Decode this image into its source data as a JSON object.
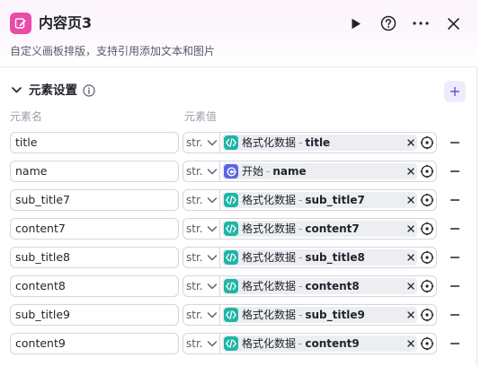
{
  "header": {
    "title": "内容页3",
    "description": "自定义画板排版，支持引用添加文本和图片"
  },
  "section": {
    "title": "元素设置"
  },
  "columns": {
    "name": "元素名",
    "value": "元素值"
  },
  "rows": [
    {
      "name": "title",
      "type": "str.",
      "source": "格式化数据",
      "sep": "-",
      "var": "title",
      "source_kind": "format"
    },
    {
      "name": "name",
      "type": "str.",
      "source": "开始",
      "sep": "-",
      "var": "name",
      "source_kind": "start"
    },
    {
      "name": "sub_title7",
      "type": "str.",
      "source": "格式化数据",
      "sep": "-",
      "var": "sub_title7",
      "source_kind": "format"
    },
    {
      "name": "content7",
      "type": "str.",
      "source": "格式化数据",
      "sep": "-",
      "var": "content7",
      "source_kind": "format"
    },
    {
      "name": "sub_title8",
      "type": "str.",
      "source": "格式化数据",
      "sep": "-",
      "var": "sub_title8",
      "source_kind": "format"
    },
    {
      "name": "content8",
      "type": "str.",
      "source": "格式化数据",
      "sep": "-",
      "var": "content8",
      "source_kind": "format"
    },
    {
      "name": "sub_title9",
      "type": "str.",
      "source": "格式化数据",
      "sep": "-",
      "var": "sub_title9",
      "source_kind": "format"
    },
    {
      "name": "content9",
      "type": "str.",
      "source": "格式化数据",
      "sep": "-",
      "var": "content9",
      "source_kind": "format"
    }
  ],
  "colors": {
    "title_icon": "#ea4aa8",
    "format_icon": "#1fb5a6",
    "start_icon": "#5b63e8",
    "add_button_bg": "#eeecfc",
    "add_button_fg": "#5b5bd6",
    "chip_bg": "#eceef2"
  },
  "icons": {
    "title": "edit-card-icon",
    "run": "play-icon",
    "help": "question-circle-icon",
    "more": "more-icon",
    "close": "close-icon",
    "collapse": "chevron-down-icon",
    "info": "info-icon",
    "add": "plus-icon",
    "format_source": "code-icon",
    "start_source": "start-node-icon",
    "clear": "close-icon",
    "reference": "target-icon",
    "remove": "minus-icon"
  }
}
